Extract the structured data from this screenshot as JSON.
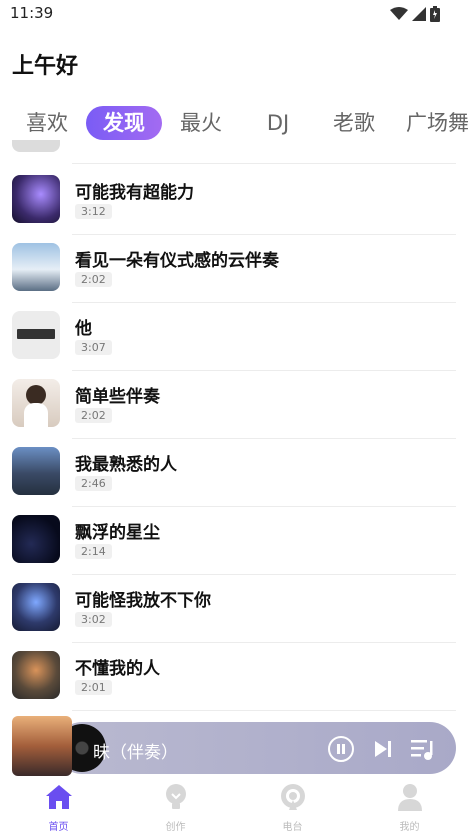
{
  "status": {
    "time": "11:39"
  },
  "header": {
    "greeting": "上午好"
  },
  "tabs": [
    {
      "label": "喜欢"
    },
    {
      "label": "发现",
      "active": true
    },
    {
      "label": "最火"
    },
    {
      "label": "DJ"
    },
    {
      "label": "老歌"
    },
    {
      "label": "广场舞"
    }
  ],
  "songs": [
    {
      "title": "",
      "duration": "",
      "cover_color": "#d9d9d9"
    },
    {
      "title": "可能我有超能力",
      "duration": "3:12",
      "cover_color": "#3b2a6b"
    },
    {
      "title": "看见一朵有仪式感的云伴奏",
      "duration": "2:02",
      "cover_color": "#6a8fb5"
    },
    {
      "title": "他",
      "duration": "3:07",
      "cover_color": "#e6e6e6"
    },
    {
      "title": "简单些伴奏",
      "duration": "2:02",
      "cover_color": "#e9e2dc"
    },
    {
      "title": "我最熟悉的人",
      "duration": "2:46",
      "cover_color": "#4a5d80"
    },
    {
      "title": "飘浮的星尘",
      "duration": "2:14",
      "cover_color": "#0f1433"
    },
    {
      "title": "可能怪我放不下你",
      "duration": "3:02",
      "cover_color": "#2e3a6b"
    },
    {
      "title": "不懂我的人",
      "duration": "2:01",
      "cover_color": "#5a4a3a"
    }
  ],
  "player": {
    "title": "昧（伴奏）",
    "cover_color": "#7a4a3a"
  },
  "bottom_nav": [
    {
      "label": "首页",
      "icon": "home-icon",
      "active": true
    },
    {
      "label": "创作",
      "icon": "lightbulb-icon"
    },
    {
      "label": "电台",
      "icon": "radio-icon"
    },
    {
      "label": "我的",
      "icon": "user-icon"
    }
  ],
  "colors": {
    "accent": "#6a4ef0",
    "tab_gradient_start": "#7a5cf5",
    "tab_gradient_end": "#a36bf2"
  }
}
